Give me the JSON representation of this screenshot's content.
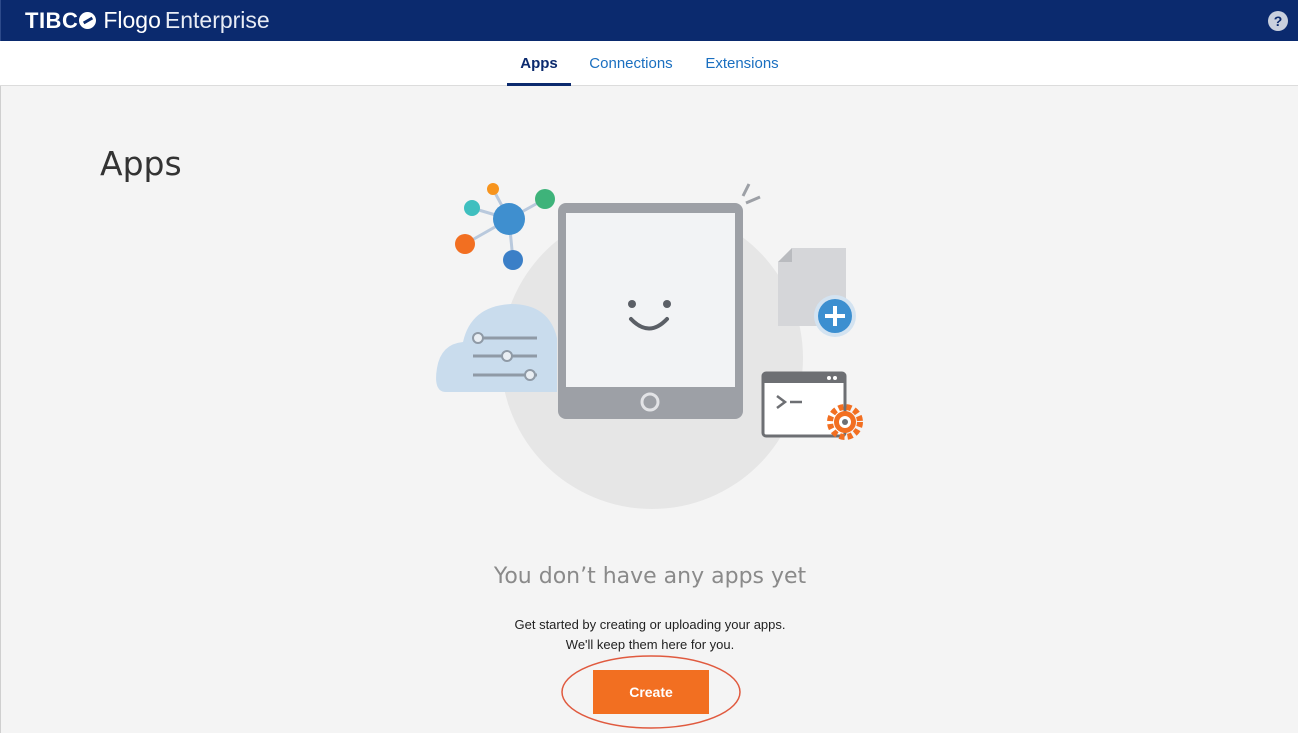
{
  "app": {
    "brand_tibco": "TIBC",
    "brand_product": "Flogo",
    "brand_edition": "Enterprise",
    "help_label": "?"
  },
  "tabs": [
    {
      "label": "Apps",
      "active": true
    },
    {
      "label": "Connections",
      "active": false
    },
    {
      "label": "Extensions",
      "active": false
    }
  ],
  "main": {
    "page_title": "Apps",
    "empty_title": "You don’t have any apps yet",
    "empty_line1": "Get started by creating or uploading your apps.",
    "empty_line2": "We'll keep them here for you.",
    "create_label": "Create"
  },
  "colors": {
    "header_bg": "#0b2a6e",
    "accent_orange": "#f26f21",
    "tab_link": "#1a6fc0",
    "page_bg": "#f4f4f4"
  }
}
